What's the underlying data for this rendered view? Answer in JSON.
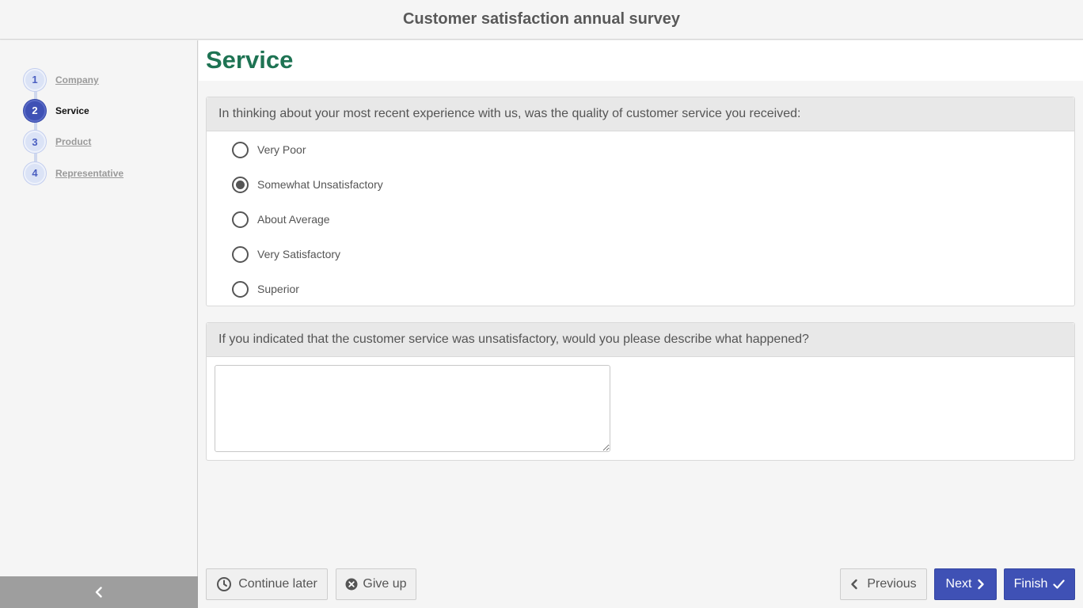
{
  "header": {
    "title": "Customer satisfaction annual survey"
  },
  "sidebar": {
    "steps": [
      {
        "number": "1",
        "label": "Company",
        "active": false
      },
      {
        "number": "2",
        "label": "Service",
        "active": true
      },
      {
        "number": "3",
        "label": "Product",
        "active": false
      },
      {
        "number": "4",
        "label": "Representative",
        "active": false
      }
    ],
    "collapse_icon": "chevron-left-icon"
  },
  "page": {
    "title": "Service",
    "question1": {
      "text": "In thinking about your most recent experience with us, was the quality of customer service you received:",
      "options": [
        "Very Poor",
        "Somewhat Unsatisfactory",
        "About Average",
        "Very Satisfactory",
        "Superior"
      ],
      "selected": "Somewhat Unsatisfactory"
    },
    "question2": {
      "text": "If you indicated that the customer service was unsatisfactory, would you please describe what happened?",
      "value": ""
    }
  },
  "footer": {
    "continue_later": "Continue later",
    "give_up": "Give up",
    "previous": "Previous",
    "next": "Next",
    "finish": "Finish"
  },
  "colors": {
    "primary": "#3f51b5",
    "title_green": "#1e7353"
  }
}
